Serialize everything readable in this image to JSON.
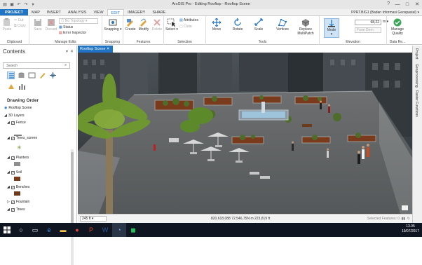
{
  "app": {
    "title": "ArcGIS Pro - Editing Rooftop - Rooftop Scene",
    "help": "?",
    "win_min": "—",
    "win_max": "□",
    "win_close": "✕"
  },
  "tabs": [
    "PROJECT",
    "MAP",
    "INSERT",
    "ANALYSIS",
    "VIEW",
    "EDIT",
    "IMAGERY",
    "SHARE"
  ],
  "active_tab": "EDIT",
  "user": "PPRT.BIG1 (Badan Informasi Geospasial) ▾",
  "ribbon": {
    "clipboard": {
      "label": "Clipboard",
      "paste": "Paste",
      "cut": "Cut",
      "copy": "Copy"
    },
    "manage_edits": {
      "label": "Manage Edits",
      "save": "Save",
      "discard": "Discard",
      "no_topology": "No Topology",
      "status": "Status",
      "error_inspector": "Error Inspector"
    },
    "snapping": {
      "label": "Snapping",
      "snapping": "Snapping"
    },
    "features": {
      "label": "Features",
      "create": "Create",
      "modify": "Modify",
      "delete": "Delete"
    },
    "selection": {
      "label": "Selection",
      "select": "Select",
      "attributes": "Attributes",
      "clear": "Clear"
    },
    "tools": {
      "label": "Tools",
      "move": "Move",
      "rotate": "Rotate",
      "scale": "Scale",
      "vertices": "Vertices",
      "replace_multipatch": "Replace MultiPatch"
    },
    "elevation": {
      "label": "Elevation",
      "mode": "Mode",
      "value": "68,22",
      "unit": "m",
      "from_dem": "From Dem"
    },
    "data_review": {
      "label": "Data Re...",
      "manage_quality": "Manage Quality"
    }
  },
  "contents": {
    "title": "Contents",
    "search_placeholder": "Search",
    "drawing_order": "Drawing Order",
    "layers": [
      {
        "name": "Rooftop Scene",
        "level": 0,
        "checkbox": false
      },
      {
        "name": "3D Layers",
        "level": 1,
        "checkbox": false
      },
      {
        "name": "Fence",
        "level": 2,
        "checkbox": true
      },
      {
        "name": "Trees_screen",
        "level": 2,
        "checkbox": true
      },
      {
        "name": "Planters",
        "level": 2,
        "checkbox": true
      },
      {
        "name": "Soil",
        "level": 2,
        "checkbox": true
      },
      {
        "name": "Benches",
        "level": 2,
        "checkbox": true
      },
      {
        "name": "Fountain",
        "level": 2,
        "checkbox": true
      },
      {
        "name": "Trees",
        "level": 2,
        "checkbox": true
      }
    ]
  },
  "view": {
    "tab": "Rooftop Scene",
    "scale": "245 ft",
    "coordinates": "820.618,088 72.546,75N m   223,819 ft",
    "selected_features": "Selected Features: 0"
  },
  "right_panel": [
    "Project",
    "Geoprocessing",
    "Raster Functions"
  ],
  "taskbar": {
    "time": "13.05",
    "date": "19/07/2017"
  },
  "colors": {
    "accent": "#1f74c5",
    "soil": "#7a3a1c",
    "bench": "#6b3b1e",
    "planter": "#8e8e8e"
  }
}
